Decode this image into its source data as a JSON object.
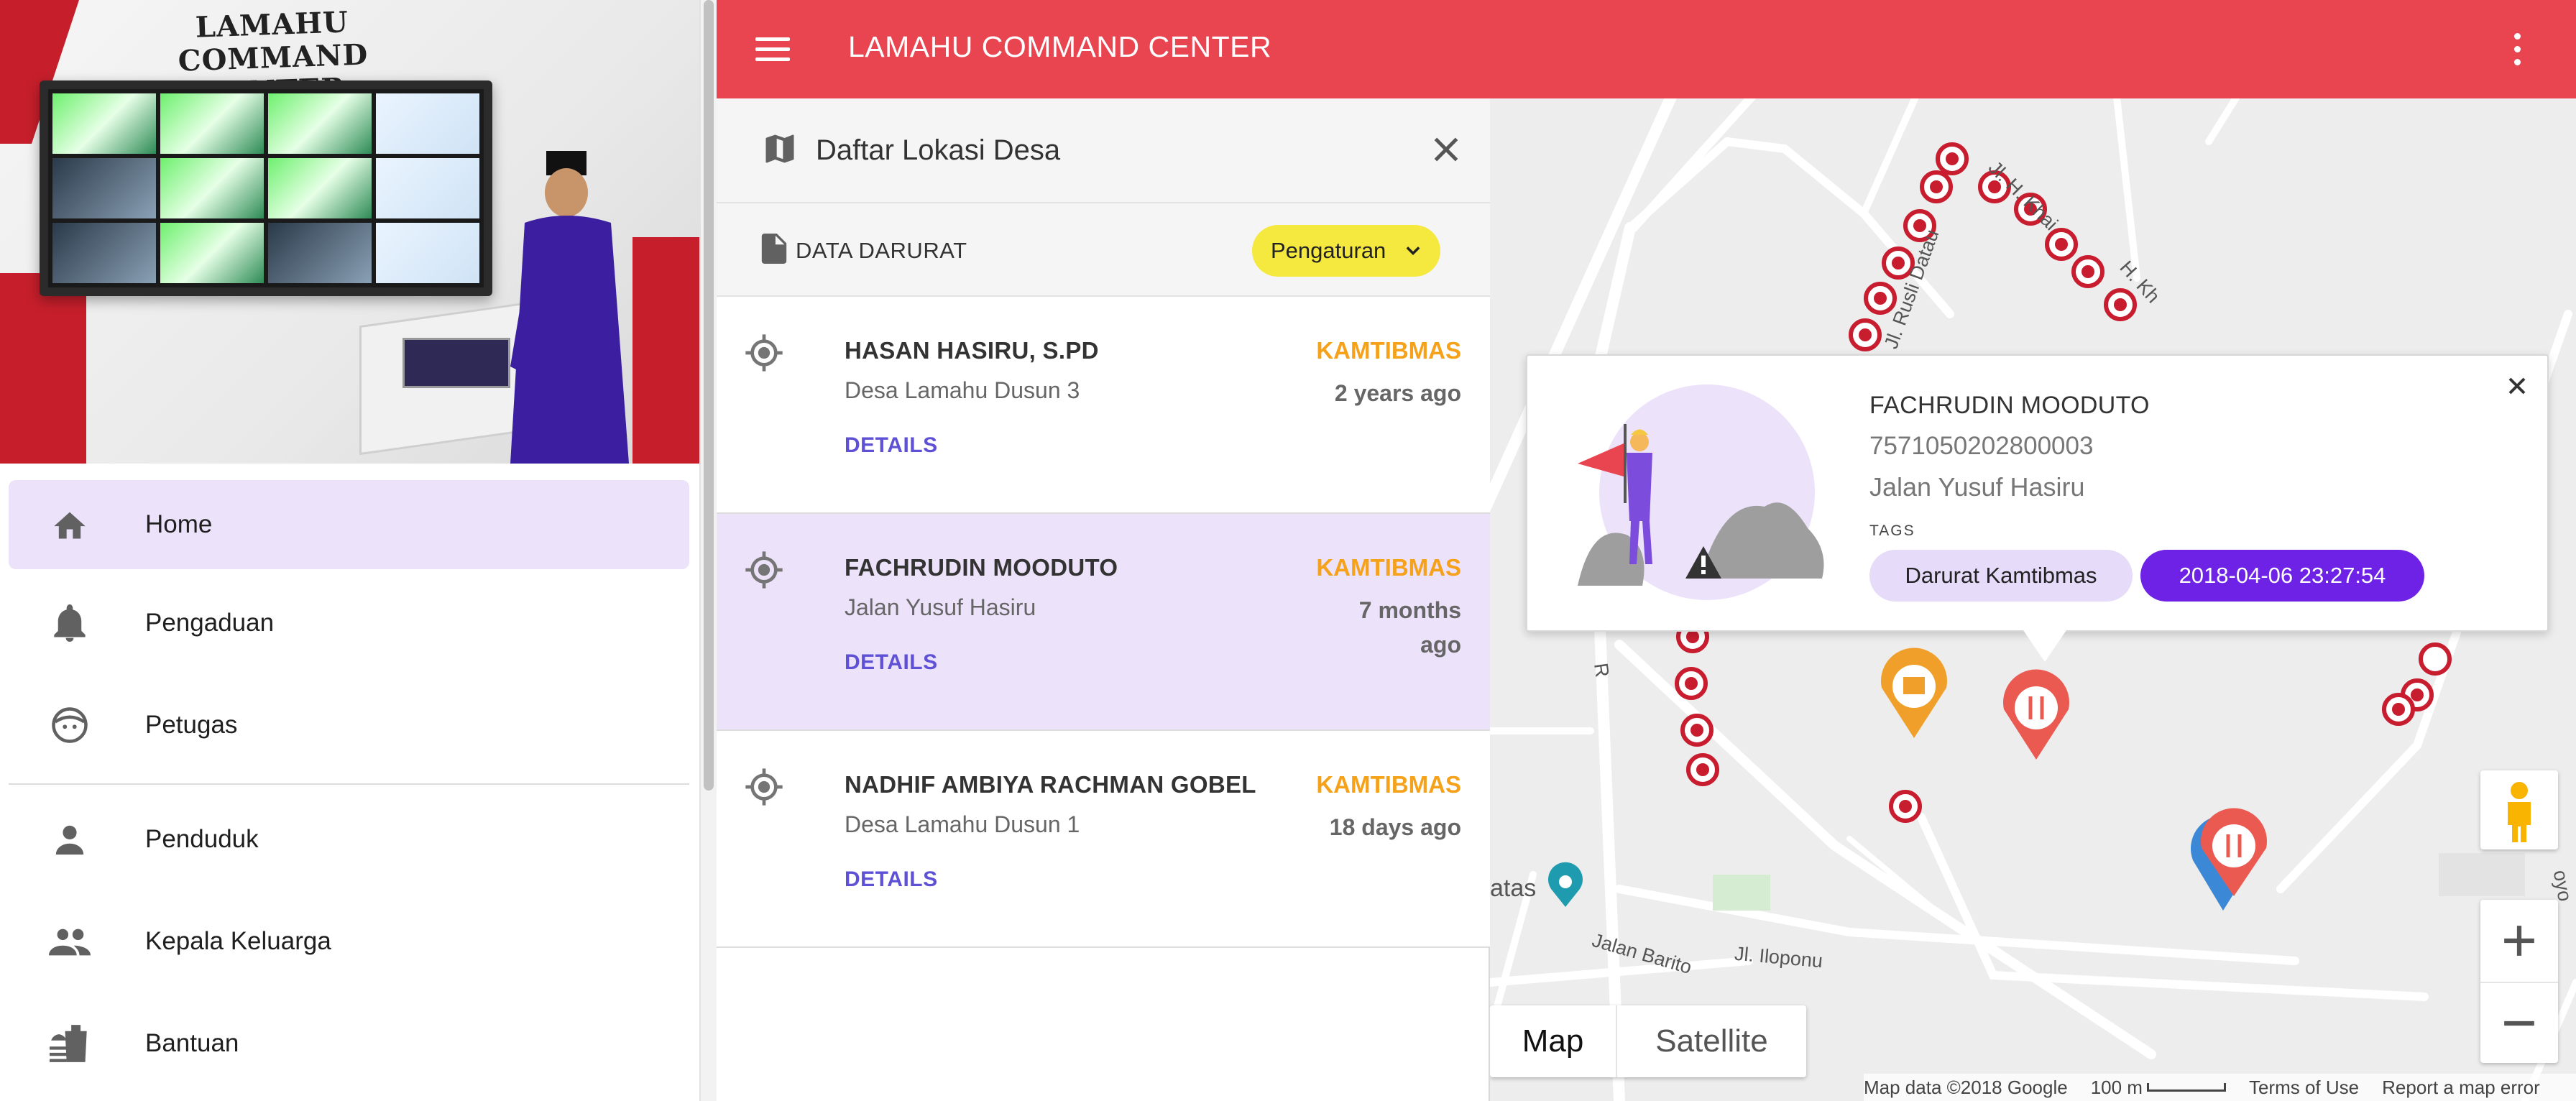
{
  "drawer": {
    "hero_text": "LAMAHU COMMAND CENTER",
    "items": [
      {
        "label": "Home",
        "icon": "home-icon",
        "active": true
      },
      {
        "label": "Pengaduan",
        "icon": "bell-icon"
      },
      {
        "label": "Petugas",
        "icon": "face-icon"
      },
      {
        "label": "Penduduk",
        "icon": "person-icon"
      },
      {
        "label": "Kepala Keluarga",
        "icon": "people-icon"
      },
      {
        "label": "Bantuan",
        "icon": "food-icon"
      }
    ]
  },
  "appbar": {
    "title": "LAMAHU COMMAND CENTER",
    "color": "#e94551"
  },
  "panel": {
    "title": "Daftar Lokasi Desa",
    "subtitle": "DATA DARURAT",
    "settings_button": "Pengaturan",
    "items": [
      {
        "name": "HASAN HASIRU, S.PD",
        "address": "Desa Lamahu Dusun 3",
        "tag": "KAMTIBMAS",
        "time": "2 years ago",
        "details": "DETAILS",
        "selected": false
      },
      {
        "name": "FACHRUDIN MOODUTO",
        "address": "Jalan Yusuf Hasiru",
        "tag": "KAMTIBMAS",
        "time": "7 months ago",
        "details": "DETAILS",
        "selected": true
      },
      {
        "name": "NADHIF AMBIYA RACHMAN GOBEL",
        "address": "Desa Lamahu Dusun 1",
        "tag": "KAMTIBMAS",
        "time": "18 days ago",
        "details": "DETAILS",
        "selected": false
      }
    ]
  },
  "map": {
    "info": {
      "name": "FACHRUDIN MOODUTO",
      "nik": "7571050202800003",
      "address": "Jalan Yusuf Hasiru",
      "tags_label": "TAGS",
      "chip_tag": "Darurat Kamtibmas",
      "chip_datetime": "2018-04-06 23:27:54"
    },
    "street_labels": {
      "jl_rusli": "Jl. Rusli Datau",
      "jl_kh": "Jl. H. Khai",
      "jalan_barito": "Jalan Barito",
      "jl_iloponu": "Jl. Iloponu",
      "atas": "atas",
      "kh2": "H. Kh",
      "r": "R",
      "oyo": "oyo"
    },
    "maptype": {
      "map": "Map",
      "satellite": "Satellite",
      "selected": "Map"
    },
    "footer": {
      "data": "Map data ©2018 Google",
      "scale": "100 m",
      "terms": "Terms of Use",
      "report": "Report a map error"
    }
  }
}
